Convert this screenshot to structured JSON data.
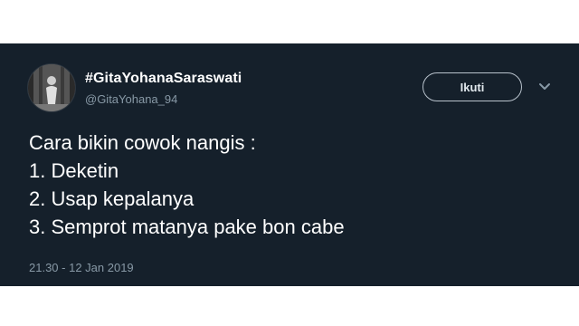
{
  "tweet": {
    "display_name": "#GitaYohanaSaraswati",
    "handle": "@GitaYohana_94",
    "follow_label": "Ikuti",
    "lines": [
      "Cara bikin cowok nangis :",
      "1. Deketin",
      "2. Usap kepalanya",
      "3. Semprot matanya pake bon cabe"
    ],
    "timestamp": "21.30 - 12 Jan 2019",
    "menu_icon": "chevron-down-icon"
  },
  "colors": {
    "background": "#15202b",
    "text": "#ffffff",
    "secondary_text": "#8899a6",
    "button_border": "#b8c2cc"
  }
}
